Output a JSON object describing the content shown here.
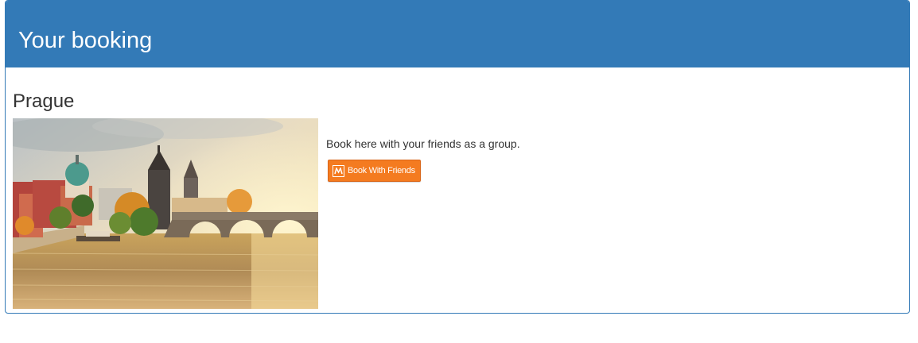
{
  "panel": {
    "title": "Your booking",
    "header_color": "#337ab7"
  },
  "booking": {
    "city": "Prague",
    "image_alt": "Prague Charles Bridge over Vltava river at sunset",
    "description": "Book here with your friends as a group.",
    "button": {
      "label": "Book With Friends",
      "icon": "bwf-logo-icon",
      "color": "#f47b20"
    }
  }
}
